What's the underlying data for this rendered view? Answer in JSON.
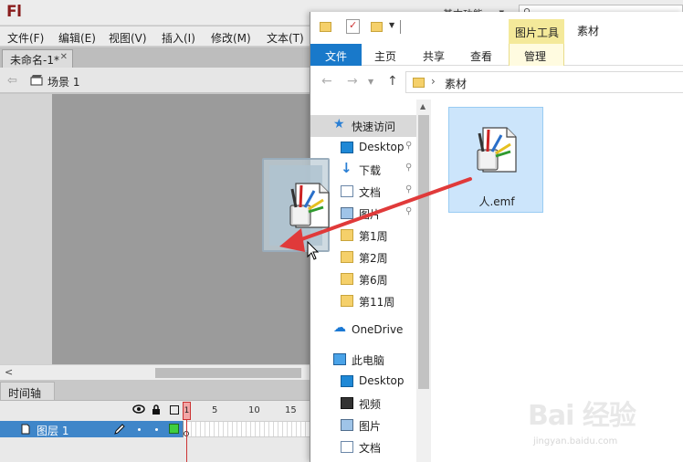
{
  "flash": {
    "logo": "Fl",
    "workspace": "基本功能",
    "menu": [
      "文件(F)",
      "编辑(E)",
      "视图(V)",
      "插入(I)",
      "修改(M)",
      "文本(T)"
    ],
    "doc_tab": "未命名-1*",
    "scene": "场景 1",
    "timeline_tab": "时间轴",
    "frame_numbers": [
      "1",
      "5",
      "10",
      "15"
    ],
    "layer_name": "图层 1"
  },
  "explorer": {
    "context_tab": "图片工具",
    "window_title": "素材",
    "ribbon_tabs": [
      "文件",
      "主页",
      "共享",
      "查看",
      "管理"
    ],
    "address_path": "素材",
    "nav_items": [
      {
        "label": "快速访问",
        "icon": "star-icon",
        "pinned": false
      },
      {
        "label": "Desktop",
        "icon": "desktop-icon",
        "pinned": true
      },
      {
        "label": "下载",
        "icon": "download-icon",
        "pinned": true
      },
      {
        "label": "文档",
        "icon": "document-icon",
        "pinned": true
      },
      {
        "label": "图片",
        "icon": "picture-icon",
        "pinned": true
      },
      {
        "label": "第1周",
        "icon": "folder-icon",
        "pinned": false
      },
      {
        "label": "第2周",
        "icon": "folder-icon",
        "pinned": false
      },
      {
        "label": "第6周",
        "icon": "folder-icon",
        "pinned": false
      },
      {
        "label": "第11周",
        "icon": "folder-icon",
        "pinned": false
      },
      {
        "label": "OneDrive",
        "icon": "cloud-icon",
        "pinned": false
      },
      {
        "label": "此电脑",
        "icon": "computer-icon",
        "pinned": false
      },
      {
        "label": "Desktop",
        "icon": "desktop-icon",
        "pinned": false
      },
      {
        "label": "视频",
        "icon": "video-icon",
        "pinned": false
      },
      {
        "label": "图片",
        "icon": "picture-icon",
        "pinned": false
      },
      {
        "label": "文档",
        "icon": "document-icon",
        "pinned": false
      }
    ],
    "file_name": "人.emf"
  },
  "watermark": {
    "text": "Bai 经验",
    "sub": "jingyan.baidu.com"
  },
  "colors": {
    "accent_blue": "#1979ca",
    "layer_blue": "#3f86c9",
    "arrow_red": "#e03a3a",
    "context_yellow": "#f4e99a",
    "selection_blue": "#cce5fb"
  }
}
